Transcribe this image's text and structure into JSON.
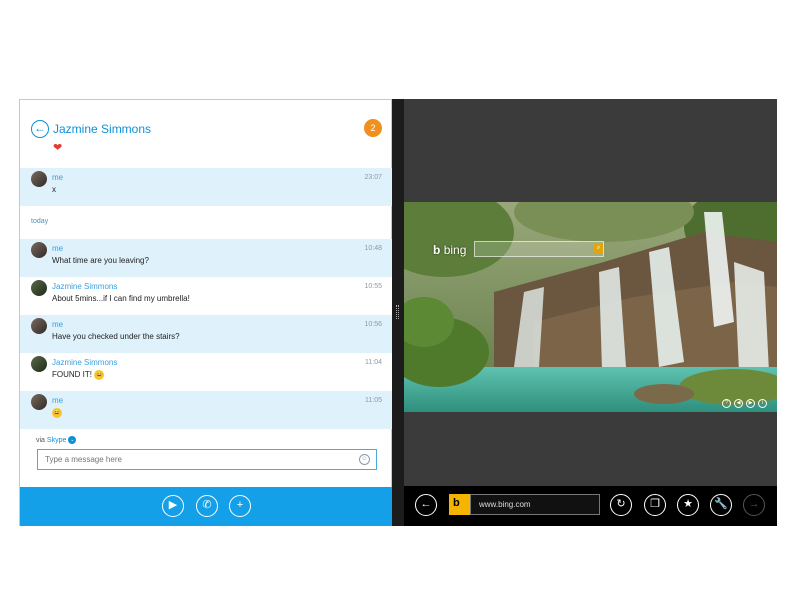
{
  "conversation": {
    "contact_name": "Jazmine Simmons",
    "mood": "❤",
    "notification_count": "2",
    "day_separator": "today",
    "messages": [
      {
        "sender": "me",
        "text": "x",
        "time": "23:07",
        "emoji": ""
      },
      {
        "sender": "me",
        "text": "What time are you leaving?",
        "time": "10:48",
        "emoji": ""
      },
      {
        "sender": "Jazmine Simmons",
        "text": "About 5mins...if I can find my umbrella!",
        "time": "10:55",
        "emoji": ""
      },
      {
        "sender": "me",
        "text": "Have you checked under the stairs?",
        "time": "10:56",
        "emoji": ""
      },
      {
        "sender": "Jazmine Simmons",
        "text": "FOUND IT!",
        "time": "11:04",
        "emoji": "😄"
      },
      {
        "sender": "me",
        "text": "",
        "time": "11:05",
        "emoji": "😄"
      }
    ],
    "via_label": "via",
    "via_service": "Skype",
    "input_placeholder": "Type a message here"
  },
  "app_bar": {
    "buttons": [
      {
        "icon": "video-call-icon",
        "glyph": "▶"
      },
      {
        "icon": "phone-call-icon",
        "glyph": "✆"
      },
      {
        "icon": "add-icon",
        "glyph": "+"
      }
    ]
  },
  "browser": {
    "bing_logo": "bing",
    "bing_logo_mark": "b",
    "url": "www.bing.com",
    "nav_icons": [
      "back-icon",
      "refresh-icon",
      "tabs-icon",
      "favorite-star-icon",
      "tools-wrench-icon",
      "forward-icon"
    ],
    "nav_glyphs": {
      "back": "←",
      "refresh": "↻",
      "tabs": "❐",
      "star": "★",
      "wrench": "🔧",
      "forward": "→"
    },
    "hero_controls": [
      "?",
      "◀",
      "▶",
      "i"
    ]
  },
  "colors": {
    "skype_blue": "#14a0e8",
    "my_message_bg": "#dff1fb",
    "badge_orange": "#f0901e",
    "browser_bg": "#3b3b3b",
    "bing_yellow": "#f5b400"
  }
}
